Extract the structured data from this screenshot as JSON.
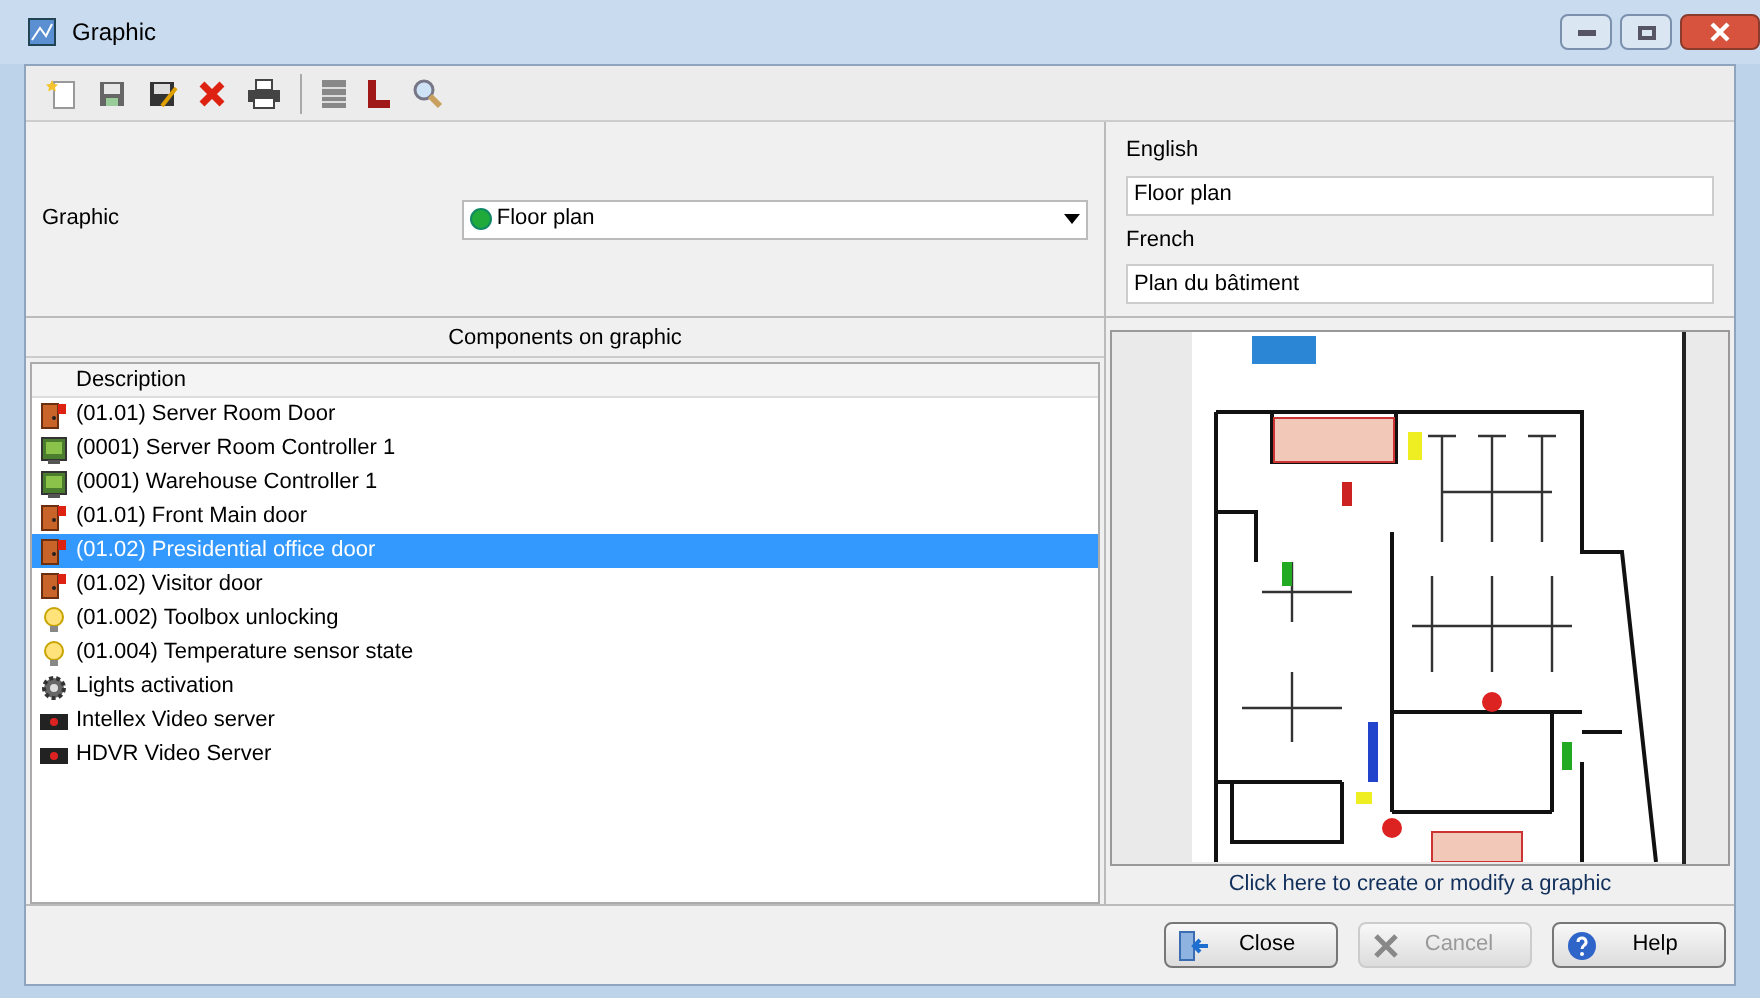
{
  "window": {
    "title": "Graphic"
  },
  "graphic_field": {
    "label": "Graphic",
    "value": "Floor plan"
  },
  "names": [
    {
      "label": "English",
      "value": "Floor plan"
    },
    {
      "label": "French",
      "value": "Plan du bâtiment"
    }
  ],
  "components": {
    "title": "Components on graphic",
    "column": "Description",
    "rows": [
      {
        "kind": "door",
        "label": "(01.01) Server Room Door",
        "selected": false
      },
      {
        "kind": "controller",
        "label": "(0001) Server Room Controller 1",
        "selected": false
      },
      {
        "kind": "controller",
        "label": "(0001) Warehouse Controller 1",
        "selected": false
      },
      {
        "kind": "door",
        "label": "(01.01) Front Main door",
        "selected": false
      },
      {
        "kind": "door",
        "label": "(01.02) Presidential office door",
        "selected": true
      },
      {
        "kind": "door",
        "label": "(01.02) Visitor door",
        "selected": false
      },
      {
        "kind": "bulb",
        "label": "(01.002) Toolbox unlocking",
        "selected": false
      },
      {
        "kind": "bulb",
        "label": "(01.004) Temperature sensor state",
        "selected": false
      },
      {
        "kind": "gear",
        "label": "Lights activation",
        "selected": false
      },
      {
        "kind": "camera",
        "label": "Intellex Video server",
        "selected": false
      },
      {
        "kind": "camera",
        "label": "HDVR Video Server",
        "selected": false
      }
    ]
  },
  "preview": {
    "action": "Click here to create or modify a graphic"
  },
  "buttons": [
    {
      "kind": "close",
      "label": "Close",
      "disabled": false
    },
    {
      "kind": "cancel",
      "label": "Cancel",
      "disabled": true
    },
    {
      "kind": "help",
      "label": "Help",
      "disabled": false
    }
  ]
}
